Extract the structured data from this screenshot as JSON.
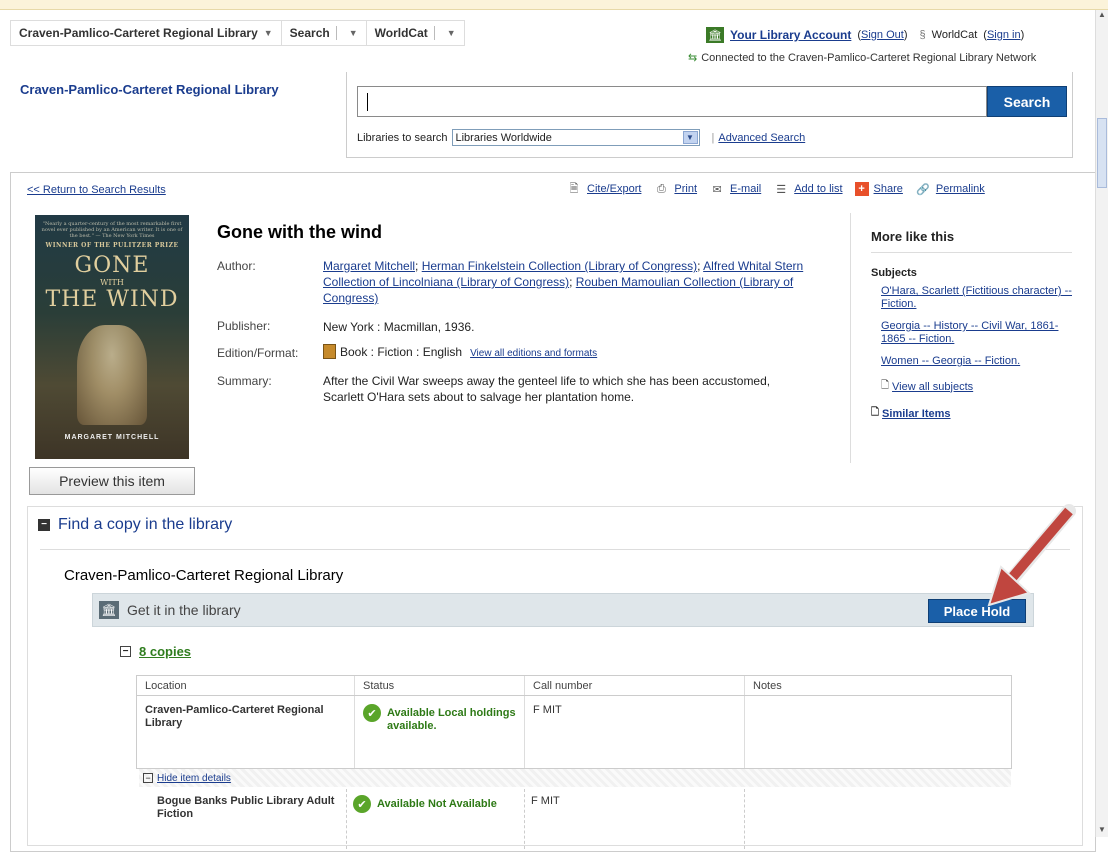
{
  "topnav": {
    "library_label": "Craven-Pamlico-Carteret Regional Library",
    "search_label": "Search",
    "worldcat_label": "WorldCat"
  },
  "account": {
    "link": "Your Library Account",
    "signout": "Sign Out",
    "worldcat": "WorldCat",
    "signin": "Sign in",
    "connected": "Connected to the Craven-Pamlico-Carteret Regional Library Network"
  },
  "header": {
    "library_name": "Craven-Pamlico-Carteret Regional Library",
    "search_button": "Search",
    "libraries_label": "Libraries to search",
    "libraries_value": "Libraries Worldwide",
    "advanced_search": "Advanced Search"
  },
  "toolbar": {
    "back": "<< Return to Search Results",
    "cite": "Cite/Export",
    "print": "Print",
    "email": "E-mail",
    "addlist": "Add to list",
    "share": "Share",
    "permalink": "Permalink"
  },
  "cover": {
    "blurb": "\"Nearly a quarter-century of the most remarkable first novel ever published by an American writer. It is one of the best.\" — The New York Times",
    "prize": "WINNER OF THE PULITZER PRIZE",
    "title_line1": "GONE",
    "title_line2": "WITH",
    "title_line3": "THE WIND",
    "author": "MARGARET MITCHELL"
  },
  "preview_button": "Preview this item",
  "item": {
    "title": "Gone with the wind",
    "author_label": "Author:",
    "authors": [
      "Margaret Mitchell",
      "Herman Finkelstein Collection (Library of Congress)",
      "Alfred Whital Stern Collection of Lincolniana (Library of Congress)",
      "Rouben Mamoulian Collection (Library of Congress)"
    ],
    "publisher_label": "Publisher:",
    "publisher": "New York : Macmillan, 1936.",
    "edition_label": "Edition/Format:",
    "edition": "Book : Fiction : English",
    "editions_link": "View all editions and formats",
    "summary_label": "Summary:",
    "summary": "After the Civil War sweeps away the genteel life to which she has been accustomed, Scarlett O'Hara sets about to salvage her plantation home."
  },
  "more_like_this": {
    "heading": "More like this",
    "subjects_label": "Subjects",
    "subjects": [
      "O'Hara, Scarlett (Fictitious character) -- Fiction.",
      "Georgia -- History -- Civil War, 1861-1865 -- Fiction.",
      "Women -- Georgia -- Fiction."
    ],
    "view_all": "View all subjects",
    "similar": "Similar Items"
  },
  "find": {
    "heading": "Find a copy in the library",
    "library": "Craven-Pamlico-Carteret Regional Library",
    "get_it": "Get it in the library",
    "place_hold": "Place Hold",
    "copies": "8 copies",
    "columns": [
      "Location",
      "Status",
      "Call number",
      "Notes"
    ],
    "row1": {
      "location": "Craven-Pamlico-Carteret Regional Library",
      "status": "Available Local holdings available.",
      "call_number": "F MIT",
      "notes": ""
    },
    "hide_details": "Hide item details",
    "row2": {
      "location": "Bogue Banks Public Library Adult Fiction",
      "status": "Available Not Available",
      "call_number": "F MIT"
    }
  },
  "colors": {
    "link": "#1a3c8e",
    "button": "#1a5fa8",
    "available": "#2e7a16",
    "arrow": "#c0463f"
  }
}
